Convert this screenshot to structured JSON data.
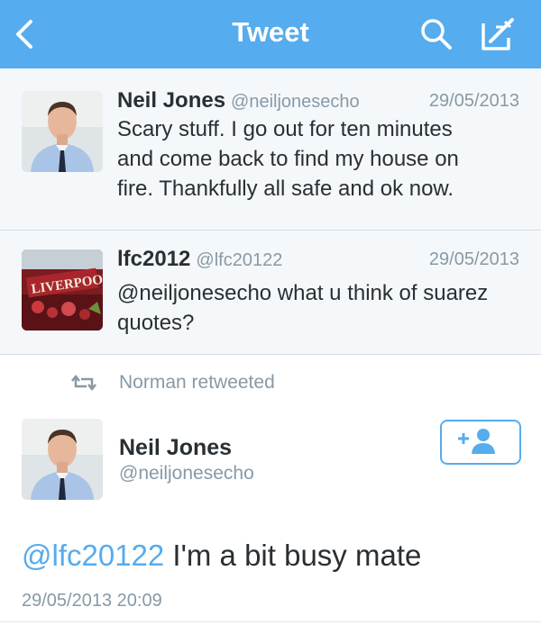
{
  "header": {
    "title": "Tweet",
    "back_icon": "chevron-left-icon",
    "search_icon": "search-icon",
    "compose_icon": "compose-icon",
    "bar_color": "#55acee"
  },
  "conversation": [
    {
      "name": "Neil Jones",
      "handle": "@neiljonesecho",
      "date": "29/05/2013",
      "text_lines": [
        "Scary stuff. I go out for ten minutes",
        "and come back to find my house on",
        "fire. Thankfully all safe and ok now."
      ]
    },
    {
      "name": "lfc2012",
      "handle": "@lfc20122",
      "date": "29/05/2013",
      "text_lines": [
        "@neiljonesecho what u think of suarez",
        "quotes?"
      ],
      "avatar_text": "LIVERPOOL"
    }
  ],
  "retweet": {
    "label": "Norman retweeted",
    "icon": "retweet-icon"
  },
  "main_tweet": {
    "name": "Neil Jones",
    "handle": "@neiljonesecho",
    "mention": "@lfc20122",
    "text": " I'm a bit busy mate",
    "timestamp": "29/05/2013 20:09",
    "follow_icon": "follow-user-icon"
  },
  "colors": {
    "accent": "#55acee",
    "muted": "#8899a6",
    "text": "#292f33"
  }
}
